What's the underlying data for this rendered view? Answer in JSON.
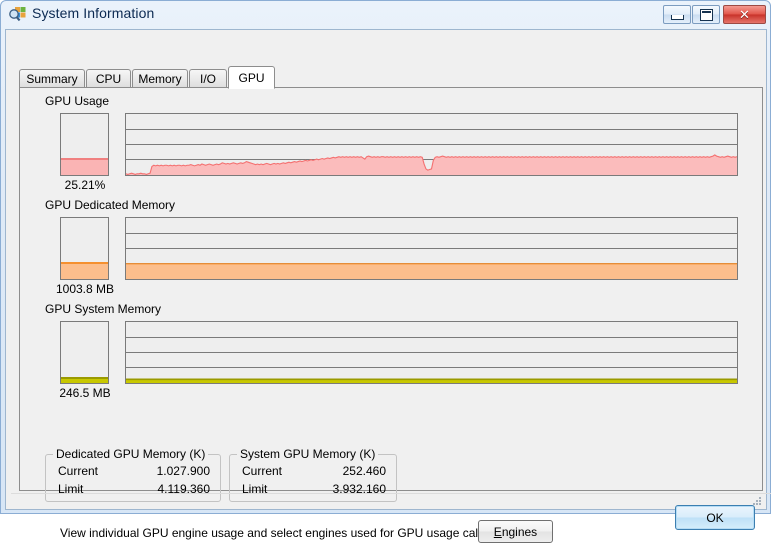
{
  "window": {
    "title": "System Information",
    "icon": "system-information-icon",
    "buttons": {
      "minimize": "minimize-icon",
      "maximize": "maximize-icon",
      "close": "✕"
    }
  },
  "tabs": [
    {
      "label": "Summary",
      "selected": false
    },
    {
      "label": "CPU",
      "selected": false
    },
    {
      "label": "Memory",
      "selected": false
    },
    {
      "label": "I/O",
      "selected": false
    },
    {
      "label": "GPU",
      "selected": true
    }
  ],
  "sections": [
    {
      "label": "GPU Usage",
      "caption": "25.21%",
      "fill_percent": 25.21,
      "color": "#fab4b4",
      "line_color": "#f07878"
    },
    {
      "label": "GPU Dedicated Memory",
      "caption": "1003.8 MB",
      "fill_percent": 24.95,
      "color": "#fcbe8c",
      "line_color": "#f08030"
    },
    {
      "label": "GPU System Memory",
      "caption": "246.5 MB",
      "fill_percent": 6.3,
      "color": "#c8c800",
      "line_color": "#9a9a00"
    }
  ],
  "groups": [
    {
      "title": "Dedicated GPU Memory (K)",
      "rows": [
        {
          "key": "Current",
          "value": "1.027.900"
        },
        {
          "key": "Limit",
          "value": "4.119.360"
        }
      ]
    },
    {
      "title": "System GPU Memory (K)",
      "rows": [
        {
          "key": "Current",
          "value": "252.460"
        },
        {
          "key": "Limit",
          "value": "3.932.160"
        }
      ]
    }
  ],
  "engines": {
    "description": "View individual GPU engine usage and select engines used for GPU usage calculations:",
    "button_accel": "E",
    "button_rest": "ngines"
  },
  "footer": {
    "ok_label": "OK"
  },
  "chart_data": [
    {
      "type": "area",
      "title": "GPU Usage",
      "ylabel": "%",
      "ylim": [
        0,
        100
      ],
      "grid": true,
      "gridlines": 3,
      "current_value": 25.21,
      "unit": "%",
      "values": [
        2,
        1,
        2,
        3,
        2,
        1,
        2,
        2,
        3,
        2,
        2,
        1,
        2,
        3,
        14,
        16,
        15,
        16,
        15,
        16,
        15,
        16,
        16,
        15,
        16,
        15,
        16,
        15,
        16,
        16,
        15,
        16,
        15,
        16,
        16,
        17,
        16,
        15,
        16,
        17,
        16,
        18,
        17,
        16,
        17,
        18,
        17,
        16,
        17,
        18,
        17,
        18,
        20,
        19,
        18,
        19,
        18,
        19,
        20,
        19,
        18,
        19,
        20,
        19,
        20,
        22,
        21,
        20,
        19,
        18,
        17,
        18,
        17,
        18,
        17,
        18,
        19,
        18,
        17,
        18,
        19,
        18,
        19,
        18,
        19,
        20,
        19,
        20,
        21,
        20,
        21,
        22,
        21,
        22,
        23,
        22,
        23,
        24,
        23,
        24,
        25,
        24,
        25,
        26,
        25,
        26,
        27,
        26,
        27,
        28,
        27,
        28,
        29,
        28,
        29,
        30,
        29,
        30,
        29,
        30,
        29,
        30,
        29,
        30,
        29,
        30,
        29,
        30,
        28,
        26,
        30,
        31,
        30,
        29,
        30,
        29,
        30,
        29,
        30,
        30,
        29,
        30,
        29,
        30,
        29,
        30,
        29,
        30,
        29,
        30,
        29,
        30,
        29,
        30,
        29,
        30,
        29,
        30,
        29,
        30,
        29,
        18,
        10,
        8,
        9,
        10,
        24,
        29,
        30,
        29,
        30,
        31,
        30,
        29,
        30,
        29,
        30,
        29,
        30,
        29,
        30,
        29,
        30,
        29,
        30,
        29,
        30,
        29,
        30,
        29,
        30,
        29,
        30,
        29,
        30,
        29,
        30,
        29,
        30,
        29,
        30,
        29,
        30,
        29,
        30,
        29,
        30,
        29,
        30,
        29,
        30,
        29,
        30,
        29,
        30,
        29,
        30,
        29,
        30,
        29,
        30,
        29,
        30,
        29,
        30,
        29,
        30,
        29,
        30,
        29,
        30,
        29,
        30,
        29,
        30,
        29,
        30,
        29,
        30,
        29,
        30,
        29,
        30,
        29,
        30,
        29,
        30,
        29,
        30,
        29,
        30,
        29,
        30,
        29,
        30,
        29,
        30,
        29,
        30,
        29,
        30,
        29,
        30,
        29,
        30,
        29,
        30,
        29,
        30,
        29,
        30,
        29,
        30,
        29,
        30,
        29,
        30,
        29,
        30,
        29,
        30,
        29,
        30,
        29,
        30,
        29,
        30,
        29,
        30,
        29,
        30,
        29,
        30,
        29,
        30,
        29,
        30,
        29,
        30,
        29,
        30,
        29,
        30,
        29,
        30,
        29,
        30,
        29,
        30,
        29,
        30,
        29,
        30,
        29,
        30,
        29,
        30,
        31,
        33,
        31,
        30,
        29,
        30,
        29,
        30,
        31,
        30,
        29,
        30,
        29,
        30
      ]
    },
    {
      "type": "area",
      "title": "GPU Dedicated Memory",
      "ylabel": "MB",
      "ylim": [
        0,
        4023
      ],
      "grid": true,
      "gridlines": 3,
      "current_value": 1003.8,
      "unit": "MB",
      "values": [
        25,
        25,
        25,
        25,
        25,
        25,
        25,
        25,
        25,
        25,
        25,
        25,
        25,
        25,
        25,
        25,
        25,
        25,
        25,
        25,
        25,
        25,
        25,
        25,
        25,
        25,
        25,
        25,
        25,
        25,
        25,
        25,
        25,
        25,
        25,
        25,
        25,
        25,
        25,
        25,
        25,
        25,
        25,
        25,
        25,
        25,
        25,
        25,
        25,
        25,
        25,
        25,
        25,
        25,
        25,
        25,
        25,
        25,
        25,
        25,
        25,
        25,
        25,
        25,
        25,
        25,
        25,
        25,
        25,
        25,
        25,
        25,
        25,
        25,
        25,
        25,
        25,
        25,
        25,
        25,
        25,
        25,
        25,
        25,
        25,
        25,
        25,
        25,
        25,
        25,
        25,
        25,
        25,
        25,
        25,
        25,
        25,
        25,
        25,
        25,
        25,
        25,
        25,
        25,
        25,
        25,
        25,
        25,
        25,
        25,
        25,
        25,
        25,
        25,
        25,
        25,
        25,
        25,
        25,
        25,
        25,
        25,
        25,
        25,
        25,
        25,
        25,
        25,
        25,
        25,
        25,
        25,
        25,
        25,
        25,
        25,
        25,
        25,
        25,
        25,
        25,
        25,
        25,
        25,
        25,
        25,
        25,
        25,
        25,
        25,
        25,
        25,
        25,
        25,
        25,
        25,
        25,
        25,
        25,
        25,
        25,
        25,
        25,
        25,
        25,
        25,
        25,
        25,
        25,
        25,
        25,
        25,
        25,
        25,
        25,
        25,
        25,
        25,
        25,
        25,
        25,
        25,
        25,
        25,
        25,
        25,
        25,
        25,
        25,
        25,
        25,
        25,
        25,
        25,
        25,
        25,
        25,
        25,
        25,
        25,
        25,
        25,
        25,
        25,
        25,
        25,
        25,
        25,
        25,
        25,
        25,
        25,
        25,
        25,
        25,
        25,
        25,
        25,
        25,
        25,
        25,
        25,
        25,
        25,
        25,
        25,
        25,
        25,
        25,
        25,
        25,
        25,
        25,
        25,
        25,
        25,
        25,
        25,
        25,
        25,
        25,
        25,
        25,
        25,
        25,
        25,
        25,
        25,
        25,
        25,
        25,
        25,
        25,
        25,
        25,
        25,
        25,
        25,
        25,
        25,
        25,
        25,
        25,
        25,
        25,
        25,
        25,
        25,
        25,
        25,
        25,
        25,
        25,
        25,
        25,
        25,
        25,
        25,
        25,
        25,
        25,
        25,
        25,
        25,
        25,
        25,
        25,
        25,
        25,
        25,
        25,
        25,
        25,
        25,
        25,
        25,
        25,
        25,
        25,
        25,
        25,
        25,
        25,
        25,
        25,
        25,
        25,
        25,
        25,
        25,
        25,
        25,
        25,
        25,
        25,
        25,
        25,
        25,
        25,
        25,
        25,
        25,
        25,
        25,
        25,
        25,
        25,
        25,
        25,
        25,
        25,
        25,
        25,
        25,
        25,
        25
      ]
    },
    {
      "type": "area",
      "title": "GPU System Memory",
      "ylabel": "MB",
      "ylim": [
        0,
        3840
      ],
      "grid": true,
      "gridlines": 3,
      "current_value": 246.5,
      "unit": "MB",
      "values": [
        6,
        6,
        6,
        6,
        6,
        6,
        6,
        6,
        6,
        6,
        6,
        6,
        6,
        6,
        6,
        6,
        6,
        6,
        6,
        6,
        6,
        6,
        6,
        6,
        6,
        6,
        6,
        6,
        6,
        6,
        6,
        6,
        6,
        6,
        6,
        6,
        6,
        6,
        6,
        6,
        6,
        6,
        6,
        6,
        6,
        6,
        6,
        6,
        6,
        6,
        6,
        6,
        6,
        6,
        6,
        6,
        6,
        6,
        6,
        6,
        6,
        6,
        6,
        6,
        6,
        6,
        6,
        6,
        6,
        6,
        6,
        6,
        6,
        6,
        6,
        6,
        6,
        6,
        6,
        6,
        6,
        6,
        6,
        6,
        6,
        6,
        6,
        6,
        6,
        6,
        6,
        6,
        6,
        6,
        6,
        6,
        6,
        6,
        6,
        6,
        6,
        6,
        6,
        6,
        6,
        6,
        6,
        6,
        6,
        6,
        6,
        6,
        6,
        6,
        6,
        6,
        6,
        6,
        6,
        6,
        6,
        6,
        6,
        6,
        6,
        6,
        6,
        6,
        6,
        6,
        6,
        6,
        6,
        6,
        6,
        6,
        6,
        6,
        6,
        6,
        6,
        6,
        6,
        6,
        6,
        6,
        6,
        6,
        6,
        6,
        6,
        6,
        6,
        6,
        6,
        6,
        6,
        6,
        6,
        6,
        6,
        6,
        6,
        6,
        6,
        6,
        6,
        6,
        6,
        6,
        6,
        6,
        6,
        6,
        6,
        6,
        6,
        6,
        6,
        6,
        6,
        6,
        6,
        6,
        6,
        6,
        6,
        6,
        6,
        6,
        6,
        6,
        6,
        6,
        6,
        6,
        6,
        6,
        6,
        6,
        6,
        6,
        6,
        6,
        6,
        6,
        6,
        6,
        6,
        6,
        6,
        6,
        6,
        6,
        6,
        6,
        6,
        6,
        6,
        6,
        6,
        6,
        6,
        6,
        6,
        6,
        6,
        6,
        6,
        6,
        6,
        6,
        6,
        6,
        6,
        6,
        6,
        6,
        6,
        6,
        6,
        6,
        6,
        6,
        6,
        6,
        6,
        6,
        6,
        6,
        6,
        6,
        6,
        6,
        6,
        6,
        6,
        6,
        6,
        6,
        6,
        6,
        6,
        6,
        6,
        6,
        6,
        6,
        6,
        6,
        6,
        6,
        6,
        6,
        6,
        6,
        6,
        6,
        6,
        6,
        6,
        6,
        6,
        6,
        6,
        6,
        6,
        6,
        6,
        6,
        6,
        6,
        6,
        6,
        6,
        6,
        6,
        6,
        6,
        6,
        6,
        6,
        6,
        6,
        6,
        6,
        6,
        6,
        6,
        6,
        6,
        6,
        6,
        6,
        6,
        6,
        6,
        6,
        6,
        6,
        6,
        6,
        6,
        6,
        6,
        6,
        6,
        6,
        6,
        6,
        6,
        6,
        6,
        6,
        6,
        6
      ]
    }
  ]
}
